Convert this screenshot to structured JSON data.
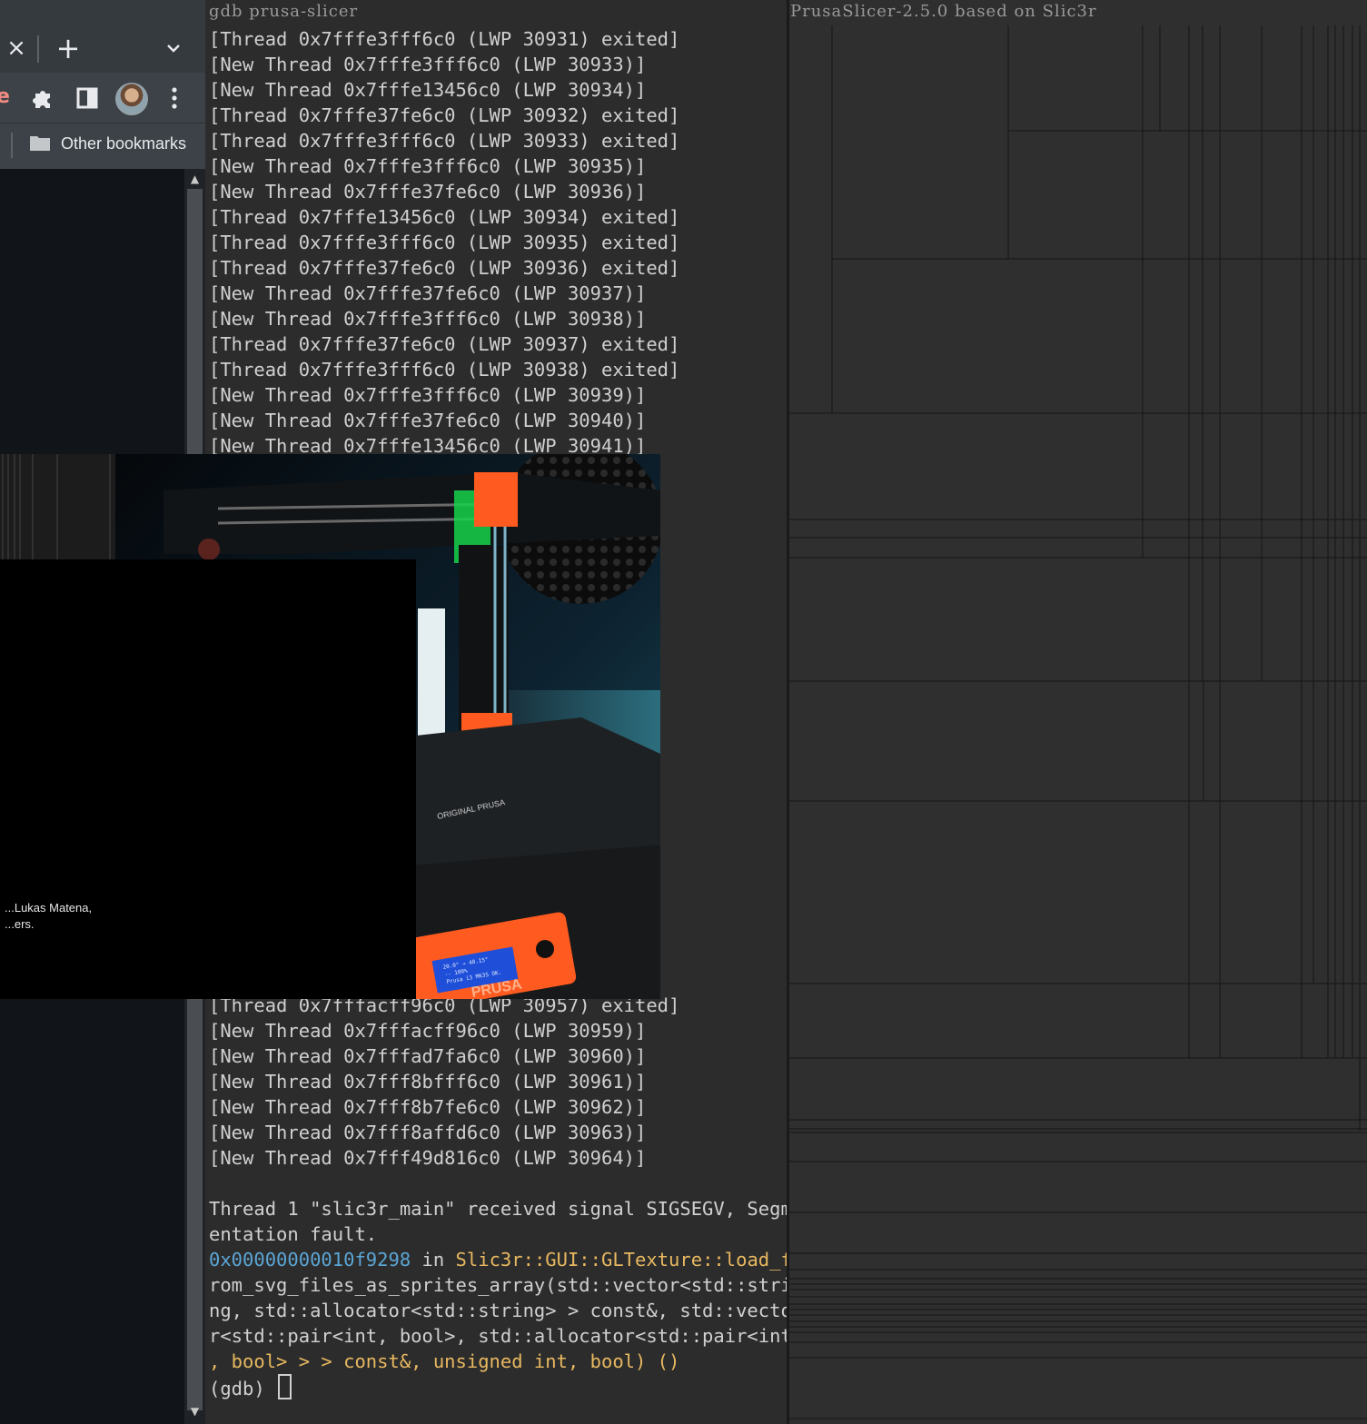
{
  "browser": {
    "bookmarks_bar": {
      "other_bookmarks_label": "Other bookmarks"
    },
    "tab_strip": {
      "close_glyph": "×",
      "new_tab_glyph": "+"
    },
    "icons": [
      "close-icon",
      "plus-icon",
      "chevron-down-icon",
      "puzzle-icon",
      "side-panel-icon",
      "avatar",
      "kebab-menu-icon",
      "folder-icon"
    ],
    "accent_color": "#3c4247",
    "scroll_arrows": {
      "up": "▲",
      "down": "▼"
    }
  },
  "terminal": {
    "title": "gdb prusa-slicer",
    "top_lines": [
      "[Thread 0x7fffe3fff6c0 (LWP 30931) exited]",
      "[New Thread 0x7fffe3fff6c0 (LWP 30933)]",
      "[New Thread 0x7fffe13456c0 (LWP 30934)]",
      "[Thread 0x7fffe37fe6c0 (LWP 30932) exited]",
      "[Thread 0x7fffe3fff6c0 (LWP 30933) exited]",
      "[New Thread 0x7fffe3fff6c0 (LWP 30935)]",
      "[New Thread 0x7fffe37fe6c0 (LWP 30936)]",
      "[Thread 0x7fffe13456c0 (LWP 30934) exited]",
      "[Thread 0x7fffe3fff6c0 (LWP 30935) exited]",
      "[Thread 0x7fffe37fe6c0 (LWP 30936) exited]",
      "[New Thread 0x7fffe37fe6c0 (LWP 30937)]",
      "[New Thread 0x7fffe3fff6c0 (LWP 30938)]",
      "[Thread 0x7fffe37fe6c0 (LWP 30937) exited]",
      "[Thread 0x7fffe3fff6c0 (LWP 30938) exited]",
      "[New Thread 0x7fffe3fff6c0 (LWP 30939)]",
      "[New Thread 0x7fffe37fe6c0 (LWP 30940)]",
      "[New Thread 0x7fffe13456c0 (LWP 30941)]"
    ],
    "bottom_lines": [
      "[Thread 0x7fffacff96c0 (LWP 30957) exited]",
      "[New Thread 0x7fffacff96c0 (LWP 30959)]",
      "[New Thread 0x7fffad7fa6c0 (LWP 30960)]",
      "[New Thread 0x7fff8bfff6c0 (LWP 30961)]",
      "[New Thread 0x7fff8b7fe6c0 (LWP 30962)]",
      "[New Thread 0x7fff8affd6c0 (LWP 30963)]",
      "[New Thread 0x7fff49d816c0 (LWP 30964)]"
    ],
    "signal_lines": [
      "Thread 1 \"slic3r_main\" received signal SIGSEGV, Segm",
      "entation fault."
    ],
    "backtrace": {
      "address": "0x00000000010f9298",
      "in_word": " in ",
      "function_lines": [
        "Slic3r::GUI::GLTexture::load_f",
        "rom_svg_files_as_sprites_array(std::vector<std::stri",
        "ng, std::allocator<std::string> > const&, std::vecto",
        "r<std::pair<int, bool>, std::allocator<std::pair<int",
        ", bool> > > const&, unsigned int, bool) ()"
      ]
    },
    "prompt": "(gdb) ",
    "colors": {
      "address": "#5ba6d6",
      "function": "#e8b860",
      "text": "#d0d0d0"
    }
  },
  "slicer": {
    "title": "PrusaSlicer-2.5.0 based on Slic3r"
  },
  "overlay": {
    "credit_lines": [
      "...Lukas Matena,",
      "...ers."
    ],
    "photo_label": "ORIGINAL PRUSA",
    "lcd_readout": [
      "20.0°  → 40.15°",
      "  --   100%",
      "Prusa i3 MK3S OK."
    ],
    "logo_text": "PRUSA"
  }
}
